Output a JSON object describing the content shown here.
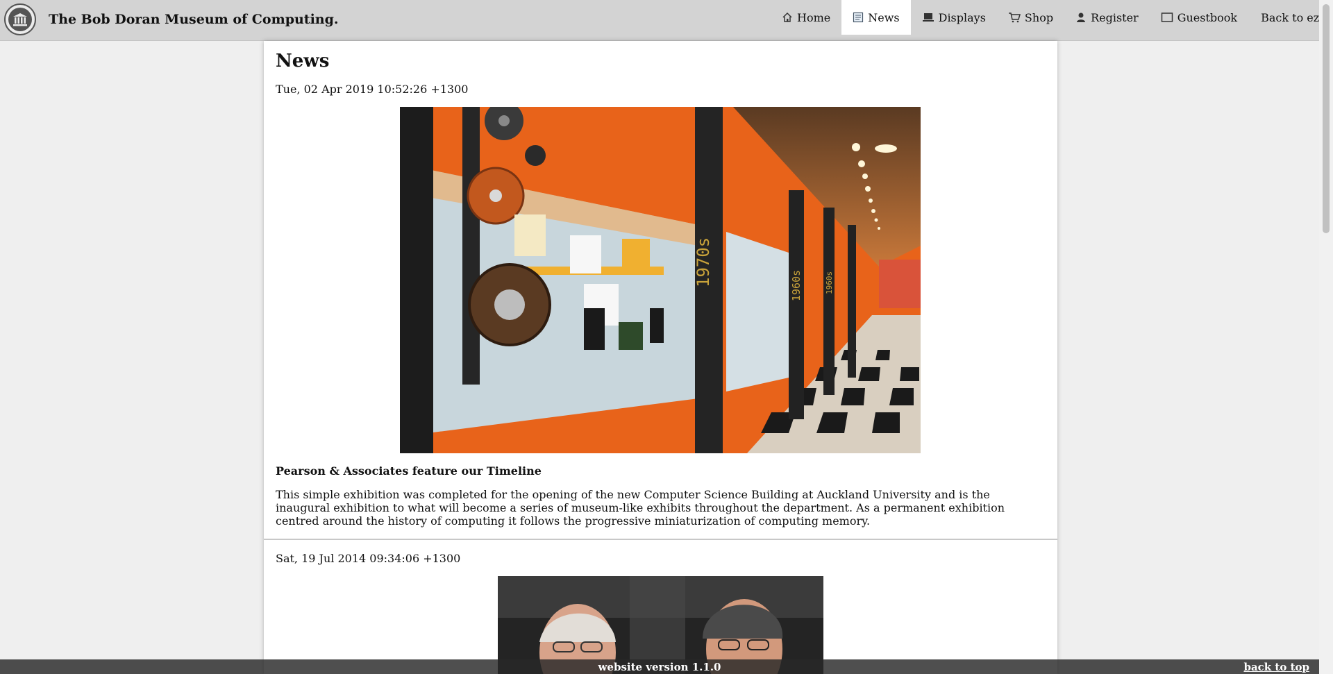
{
  "site": {
    "title": "The Bob Doran Museum of Computing."
  },
  "nav": {
    "items": [
      {
        "label": "Home",
        "icon": "home-icon"
      },
      {
        "label": "News",
        "icon": "news-icon",
        "active": true
      },
      {
        "label": "Displays",
        "icon": "laptop-icon"
      },
      {
        "label": "Shop",
        "icon": "cart-icon"
      },
      {
        "label": "Register",
        "icon": "user-icon"
      },
      {
        "label": "Guestbook",
        "icon": "book-icon"
      },
      {
        "label": "Back to ezzydev"
      }
    ]
  },
  "page": {
    "title": "News"
  },
  "news": [
    {
      "date": "Tue, 02 Apr 2019 10:52:26 +1300",
      "heading": "Pearson & Associates feature our Timeline",
      "body": "This simple exhibition was completed for the opening of the new Computer Science Building at Auckland University and is the inaugural exhibition to what will become a series of museum-like exhibits throughout the department. As a permanent exhibition centred around the history of computing it follows the progressive miniaturization of computing memory.",
      "image_labels": [
        "1970s",
        "1960s",
        "1960s"
      ]
    },
    {
      "date": "Sat, 19 Jul 2014 09:34:06 +1300"
    }
  ],
  "footer": {
    "version": "website version 1.1.0",
    "back_to_top": "back to top"
  },
  "colors": {
    "header": "#d3d3d3",
    "background": "#efefef",
    "panel": "#ffffff",
    "footer": "#3a3a3a"
  }
}
